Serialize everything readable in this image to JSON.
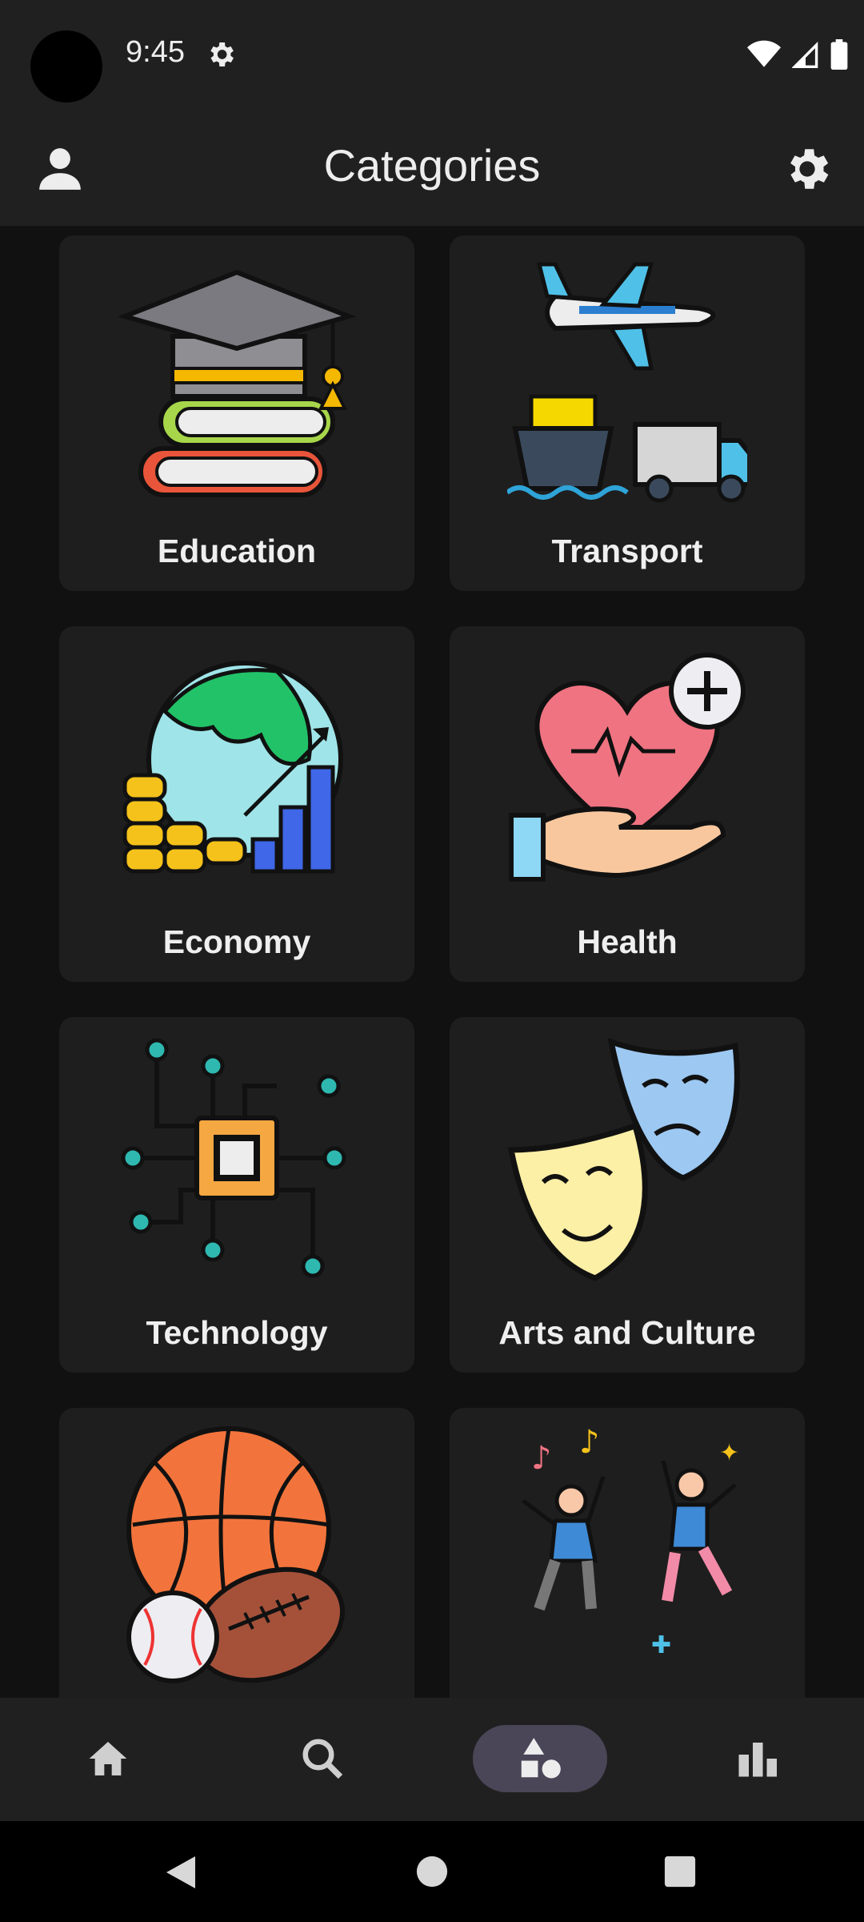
{
  "status_bar": {
    "time": "9:45"
  },
  "app_bar": {
    "title": "Categories",
    "profile_icon": "person-icon",
    "settings_icon": "gear-icon"
  },
  "categories": [
    {
      "label": "Education",
      "icon": "books-graduation-cap-icon"
    },
    {
      "label": "Transport",
      "icon": "plane-ship-truck-icon"
    },
    {
      "label": "Economy",
      "icon": "globe-coins-chart-icon"
    },
    {
      "label": "Health",
      "icon": "heart-hand-icon"
    },
    {
      "label": "Technology",
      "icon": "chip-circuit-icon"
    },
    {
      "label": "Arts and Culture",
      "icon": "theater-masks-icon"
    },
    {
      "label": "",
      "icon": "sports-balls-icon"
    },
    {
      "label": "",
      "icon": "dancing-people-icon"
    }
  ],
  "bottom_nav": [
    {
      "name": "home",
      "icon": "home-icon",
      "active": false
    },
    {
      "name": "search",
      "icon": "search-icon",
      "active": false
    },
    {
      "name": "categories",
      "icon": "shapes-icon",
      "active": true
    },
    {
      "name": "stats",
      "icon": "bar-chart-icon",
      "active": false
    }
  ],
  "colors": {
    "background": "#111111",
    "bar": "#202020",
    "card": "#1E1E1E",
    "active_pill": "#4A4658"
  }
}
